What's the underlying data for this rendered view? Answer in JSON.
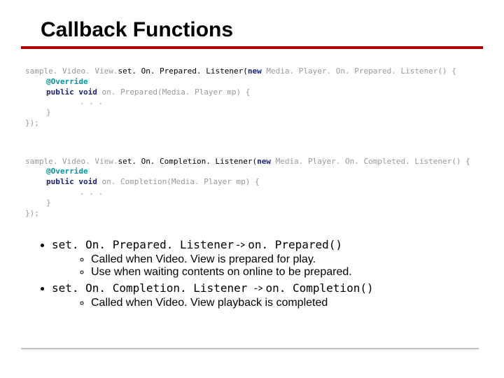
{
  "title": "Callback Functions",
  "code1": {
    "obj": "sample. Video. View.",
    "setCall": "set. On. Prepared. Listener(",
    "newKw": "new",
    "type": " Media. Player. On. Prepared. Listener() {",
    "override": "@Override",
    "pub": "public",
    "voi": " void ",
    "meth": "on. Prepared(Media. Player mp) {",
    "dots": ". . .",
    "closeBrace": "}",
    "closeAll": "});"
  },
  "code2": {
    "obj": "sample. Video. View.",
    "setCall": "set. On. Completion. Listener(",
    "newKw": "new",
    "type": " Media. Player. On. Completed. Listener() {",
    "override": "@Override",
    "pub": "public",
    "voi": " void ",
    "meth": "on. Completion(Media. Player mp) {",
    "dots": ". . .",
    "closeBrace": "}",
    "closeAll": "});"
  },
  "bullets": {
    "b1": {
      "left": "set. On. Prepared. Listener",
      "arrow": " -> ",
      "right": "on. Prepared()"
    },
    "b1a": "Called when Video. View is prepared for play.",
    "b1b": "Use when waiting contents on online to be prepared.",
    "b2": {
      "left": "set. On. Completion. Listener ",
      "arrow": " -> ",
      "right": "on. Completion()"
    },
    "b2a": "Called when Video. View playback is completed"
  }
}
